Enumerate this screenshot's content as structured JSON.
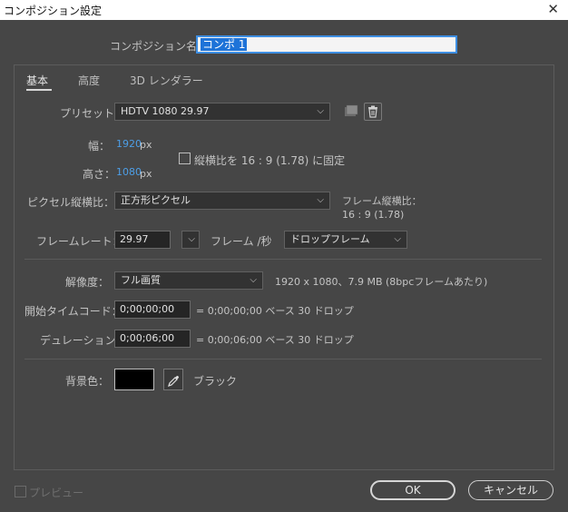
{
  "window": {
    "title": "コンポジション設定",
    "close_glyph": "✕"
  },
  "comp_name": {
    "label": "コンポジション名：",
    "value": "コンポ 1"
  },
  "tabs": [
    {
      "label": "基本",
      "active": true
    },
    {
      "label": "高度",
      "active": false
    },
    {
      "label": "3D レンダラー",
      "active": false
    }
  ],
  "preset": {
    "label": "プリセット：",
    "value": "HDTV 1080 29.97"
  },
  "width": {
    "label": "幅：",
    "value": "1920",
    "unit": "px"
  },
  "height": {
    "label": "高さ：",
    "value": "1080",
    "unit": "px"
  },
  "lock_aspect": {
    "label": "縦横比を 16 : 9 (1.78) に固定",
    "checked": false
  },
  "pixel_aspect": {
    "label": "ピクセル縦横比：",
    "value": "正方形ピクセル"
  },
  "frame_aspect": {
    "label": "フレーム縦横比：",
    "value": "16 : 9 (1.78)"
  },
  "frame_rate": {
    "label": "フレームレート：",
    "value": "29.97",
    "unit": "フレーム /秒",
    "drop_value": "ドロップフレーム"
  },
  "resolution": {
    "label": "解像度：",
    "value": "フル画質",
    "info": "1920 x 1080、7.9 MB (8bpcフレームあたり)"
  },
  "start_timecode": {
    "label": "開始タイムコード：",
    "value": "0;00;00;00",
    "info": "= 0;00;00;00  ベース 30  ドロップ"
  },
  "duration": {
    "label": "デュレーション：",
    "value": "0;00;06;00",
    "info": "= 0;00;06;00  ベース 30  ドロップ"
  },
  "background": {
    "label": "背景色：",
    "color_name": "ブラック",
    "color": "#000000"
  },
  "preview": {
    "label": "プレビュー",
    "checked": false
  },
  "buttons": {
    "ok": "OK",
    "cancel": "キャンセル"
  },
  "colors": {
    "accent": "#3d8ee2",
    "value_blue": "#4d9ee6",
    "background": "#464646"
  }
}
